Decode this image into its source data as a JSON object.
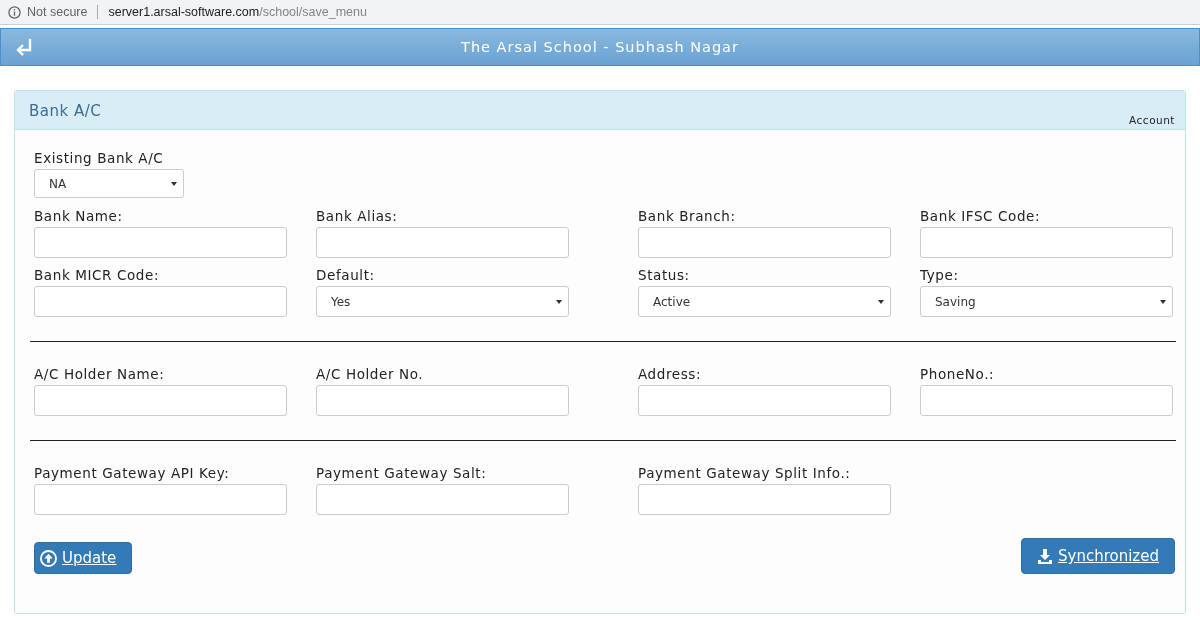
{
  "browser": {
    "security": "Not secure",
    "url_host": "server1.arsal-software.com",
    "url_path": "/school/save_menu"
  },
  "header": {
    "title": "The Arsal School - Subhash Nagar"
  },
  "panel": {
    "title": "Bank A/C",
    "subtitle": "Account",
    "existing": {
      "label": "Existing Bank A/C",
      "value": "NA"
    },
    "sections": [
      {
        "fields": [
          {
            "label": "Bank Name:",
            "kind": "text"
          },
          {
            "label": "Bank Alias:",
            "kind": "text"
          },
          {
            "label": "Bank Branch:",
            "kind": "text"
          },
          {
            "label": "Bank IFSC Code:",
            "kind": "text"
          },
          {
            "label": "Bank MICR Code:",
            "kind": "text"
          },
          {
            "label": "Default:",
            "kind": "select",
            "value": "Yes"
          },
          {
            "label": "Status:",
            "kind": "select",
            "value": "Active"
          },
          {
            "label": "Type:",
            "kind": "select",
            "value": "Saving"
          }
        ]
      },
      {
        "fields": [
          {
            "label": "A/C Holder Name:",
            "kind": "text"
          },
          {
            "label": "A/C Holder No.",
            "kind": "text"
          },
          {
            "label": "Address:",
            "kind": "text"
          },
          {
            "label": "PhoneNo.:",
            "kind": "text"
          }
        ]
      },
      {
        "fields": [
          {
            "label": "Payment Gateway API Key:",
            "kind": "text"
          },
          {
            "label": "Payment Gateway Salt:",
            "kind": "text"
          },
          {
            "label": "Payment Gateway Split Info.:",
            "kind": "text"
          }
        ]
      }
    ],
    "buttons": [
      {
        "label": "Update",
        "kind": "update"
      },
      {
        "label": "Synchronized",
        "kind": "download"
      }
    ]
  }
}
